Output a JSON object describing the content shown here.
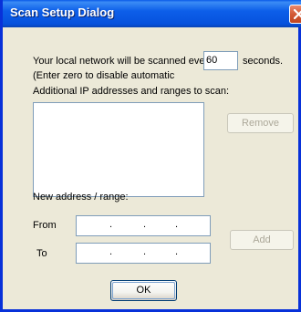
{
  "window": {
    "title": "Scan Setup Dialog"
  },
  "scan": {
    "interval_prefix": "Your local network will be scanned every",
    "interval_value": "60",
    "interval_suffix": "seconds.",
    "zero_hint": "(Enter zero to disable automatic",
    "additional_label": "Additional IP addresses and ranges to scan:"
  },
  "buttons": {
    "remove": "Remove",
    "add": "Add",
    "ok": "OK"
  },
  "range": {
    "section_label": "New address / range:",
    "from_label": "From",
    "to_label": "To",
    "dot": "."
  },
  "colors": {
    "titlebar": "#0651dd",
    "close": "#d35a37",
    "dialog_bg": "#ece9d8"
  }
}
